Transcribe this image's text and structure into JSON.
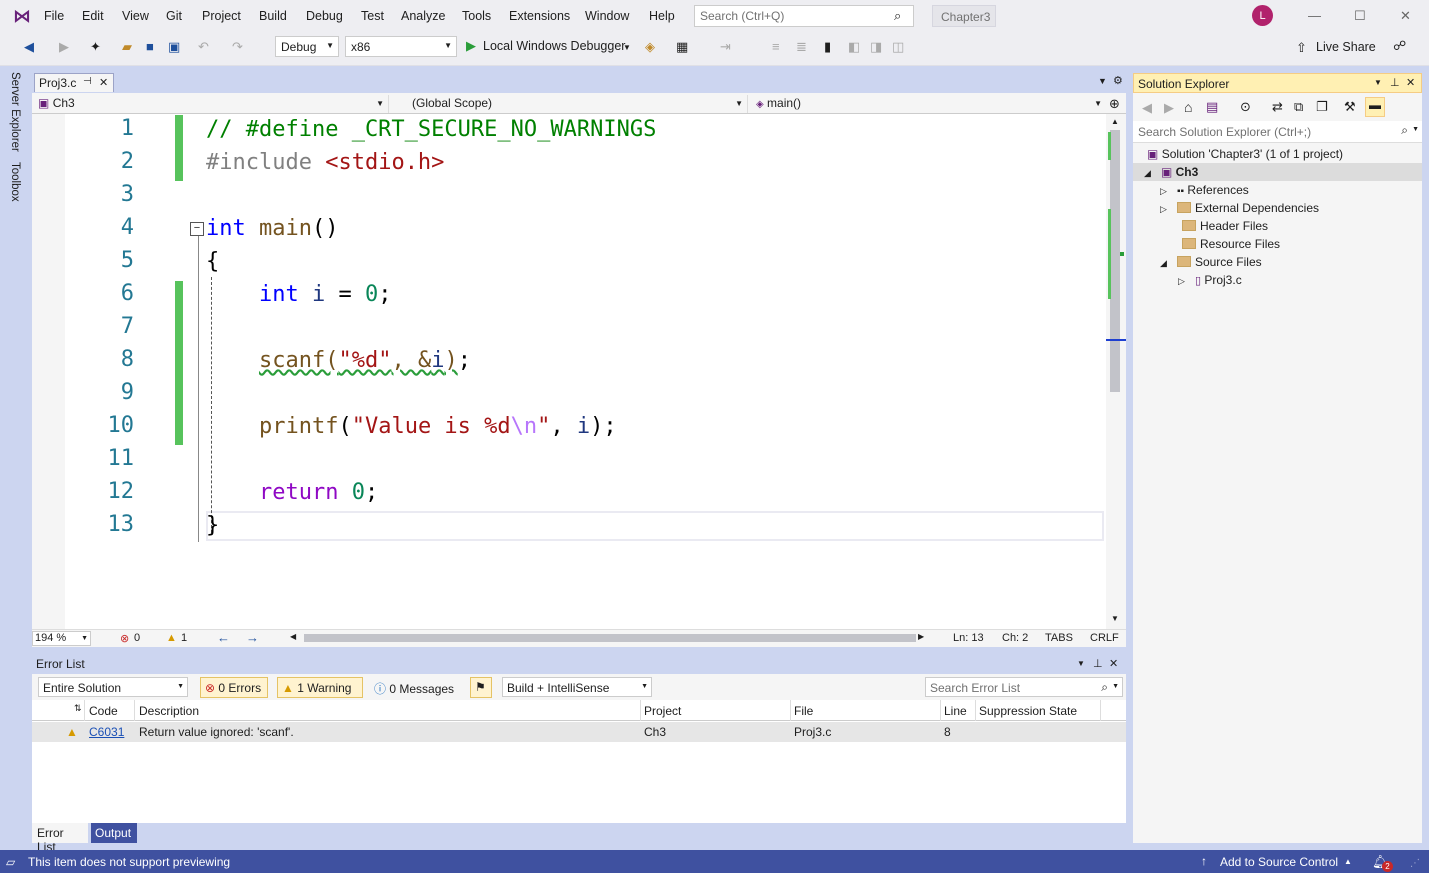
{
  "menu": [
    "File",
    "Edit",
    "View",
    "Git",
    "Project",
    "Build",
    "Debug",
    "Test",
    "Analyze",
    "Tools",
    "Extensions",
    "Window",
    "Help"
  ],
  "search": {
    "placeholder": "Search (Ctrl+Q)"
  },
  "solution_name": "Chapter3",
  "avatar": "L",
  "toolbar": {
    "config": "Debug",
    "platform": "x86",
    "debugger": "Local Windows Debugger",
    "live_share": "Live Share"
  },
  "side": {
    "server_explorer": "Server Explorer",
    "toolbox": "Toolbox"
  },
  "editor": {
    "tab": "Proj3.c",
    "nav_project": "Ch3",
    "nav_scope": "(Global Scope)",
    "nav_member": "main()",
    "line_numbers": [
      "1",
      "2",
      "3",
      "4",
      "5",
      "6",
      "7",
      "8",
      "9",
      "10",
      "11",
      "12",
      "13"
    ],
    "zoom": "194 %",
    "errors_count": "0",
    "warnings_count": "1",
    "ln": "Ln: 13",
    "ch": "Ch: 2",
    "tabs": "TABS",
    "eol": "CRLF"
  },
  "error_list": {
    "title": "Error List",
    "scope": "Entire Solution",
    "errors": "0 Errors",
    "warnings": "1 Warning",
    "messages": "0 Messages",
    "source": "Build + IntelliSense",
    "search_placeholder": "Search Error List",
    "columns": [
      "Code",
      "Description",
      "Project",
      "File",
      "Line",
      "Suppression State"
    ],
    "rows": [
      {
        "code": "C6031",
        "description": "Return value ignored: 'scanf'.",
        "project": "Ch3",
        "file": "Proj3.c",
        "line": "8",
        "state": ""
      }
    ],
    "tabs": [
      "Error List",
      "Output"
    ]
  },
  "solution_explorer": {
    "title": "Solution Explorer",
    "search_placeholder": "Search Solution Explorer (Ctrl+;)",
    "solution": "Solution 'Chapter3' (1 of 1 project)",
    "project": "Ch3",
    "nodes": [
      "References",
      "External Dependencies",
      "Header Files",
      "Resource Files",
      "Source Files"
    ],
    "file": "Proj3.c"
  },
  "statusbar": {
    "message": "This item does not support previewing",
    "source_control": "Add to Source Control",
    "notifications": "2"
  }
}
